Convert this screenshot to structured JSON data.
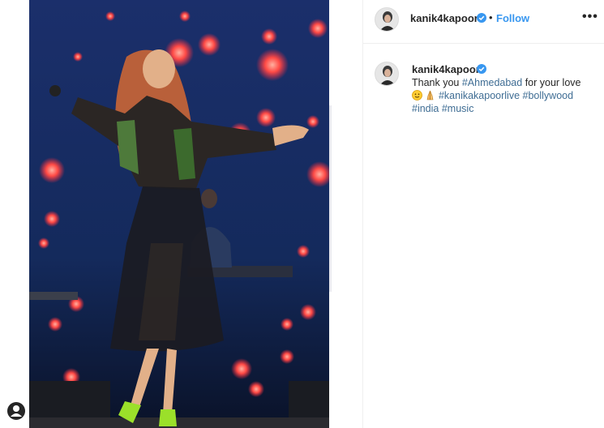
{
  "post": {
    "username": "kanik4kapoor",
    "separator": "•",
    "follow_label": "Follow",
    "more_label": "•••",
    "verified_icon": "verified-badge-icon",
    "accent_color": "#3897f0",
    "hashtag_color": "#3f6d94"
  },
  "caption": {
    "username": "kanik4kapoor",
    "text_1": "Thank you ",
    "tag_1": "#Ahmedabad",
    "text_2": " for your love",
    "emojis": [
      "hugging-face-emoji",
      "folded-hands-emoji"
    ],
    "tag_2": "#kanikakapoorlive",
    "tag_3": "#bollywood",
    "tag_4": "#india",
    "tag_5": "#music"
  },
  "photo": {
    "description_icon": "concert-photo"
  }
}
